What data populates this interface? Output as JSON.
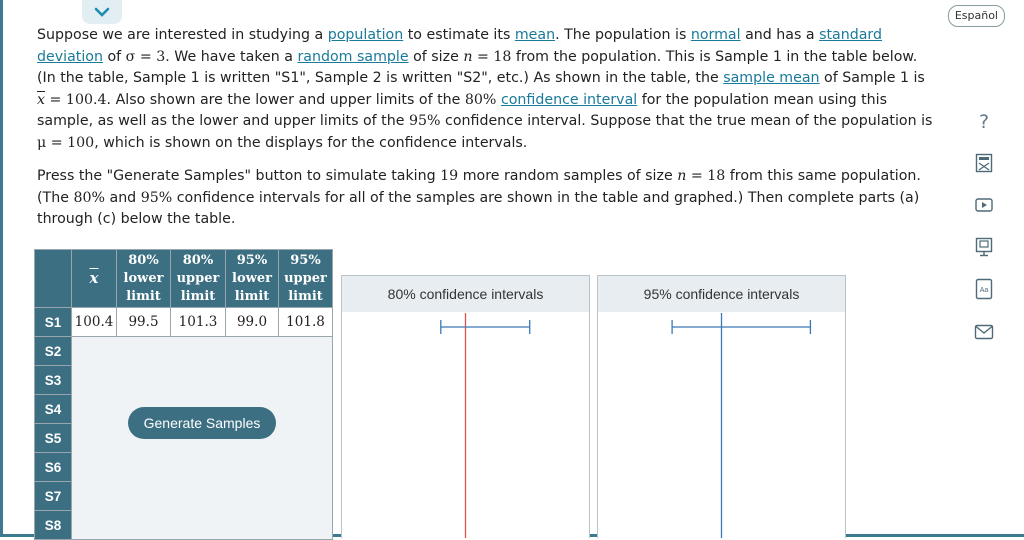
{
  "header": {
    "language_button": "Español"
  },
  "problem": {
    "p1": [
      {
        "t": "Suppose we are interested in studying a "
      },
      {
        "t": "population",
        "link": true
      },
      {
        "t": " to estimate its "
      },
      {
        "t": "mean",
        "link": true
      },
      {
        "t": ". The population is "
      },
      {
        "t": "normal",
        "link": true
      },
      {
        "t": " and has a "
      },
      {
        "t": "standard deviation",
        "link": true
      },
      {
        "t": " of "
      },
      {
        "t": "σ = 3",
        "math": true
      },
      {
        "t": ". We have taken a "
      },
      {
        "t": "random sample",
        "link": true
      },
      {
        "t": " of size "
      },
      {
        "t": "n",
        "mathi": true
      },
      {
        "t": " = 18",
        "math": true
      },
      {
        "t": " from the population. This is Sample 1 in the table below. (In the table, Sample 1 is written \"S1\", Sample 2 is written \"S2\", etc.) As shown in the table, the "
      },
      {
        "t": "sample mean",
        "link": true
      },
      {
        "t": " of Sample 1 is "
      },
      {
        "t": "x",
        "xbar": true
      },
      {
        "t": " = 100.4",
        "math": true
      },
      {
        "t": ". Also shown are the lower and upper limits of the "
      },
      {
        "t": "80%",
        "math": true
      },
      {
        "t": " "
      },
      {
        "t": "confidence interval",
        "link": true
      },
      {
        "t": " for the population mean using this sample, as well as the lower and upper limits of the "
      },
      {
        "t": "95%",
        "math": true
      },
      {
        "t": " confidence interval. Suppose that the true mean of the population is "
      },
      {
        "t": "μ = 100",
        "math": true
      },
      {
        "t": ", which is shown on the displays for the confidence intervals."
      }
    ],
    "p2": [
      {
        "t": "Press the \"Generate Samples\" button to simulate taking "
      },
      {
        "t": "19",
        "math": true
      },
      {
        "t": " more random samples of size "
      },
      {
        "t": "n",
        "mathi": true
      },
      {
        "t": " = 18",
        "math": true
      },
      {
        "t": " from this same population. (The "
      },
      {
        "t": "80%",
        "math": true
      },
      {
        "t": " and "
      },
      {
        "t": "95%",
        "math": true
      },
      {
        "t": " confidence intervals for all of the samples are shown in the table and graphed.) Then complete parts (a) through (c) below the table."
      }
    ]
  },
  "table": {
    "headers": {
      "xbar": "x",
      "c80_lower": [
        "80%",
        "lower",
        "limit"
      ],
      "c80_upper": [
        "80%",
        "upper",
        "limit"
      ],
      "c95_lower": [
        "95%",
        "lower",
        "limit"
      ],
      "c95_upper": [
        "95%",
        "upper",
        "limit"
      ]
    },
    "rows": [
      {
        "label": "S1",
        "xbar": "100.4",
        "l80": "99.5",
        "u80": "101.3",
        "l95": "99.0",
        "u95": "101.8"
      },
      {
        "label": "S2"
      },
      {
        "label": "S3"
      },
      {
        "label": "S4"
      },
      {
        "label": "S5"
      },
      {
        "label": "S6"
      },
      {
        "label": "S7"
      },
      {
        "label": "S8"
      }
    ],
    "generate_button": "Generate Samples"
  },
  "chart_data": [
    {
      "type": "interval",
      "title": "80% confidence intervals",
      "true_mean": 100,
      "true_mean_color": "#d9534f",
      "intervals": [
        {
          "sample": "S1",
          "lower": 99.5,
          "upper": 101.3
        }
      ]
    },
    {
      "type": "interval",
      "title": "95% confidence intervals",
      "true_mean": 100,
      "true_mean_color": "#3a78b8",
      "intervals": [
        {
          "sample": "S1",
          "lower": 99.0,
          "upper": 101.8
        }
      ]
    }
  ],
  "sidebar_icons": [
    "help-icon",
    "calculator-icon",
    "video-icon",
    "textbook-icon",
    "glossary-icon",
    "message-icon"
  ]
}
